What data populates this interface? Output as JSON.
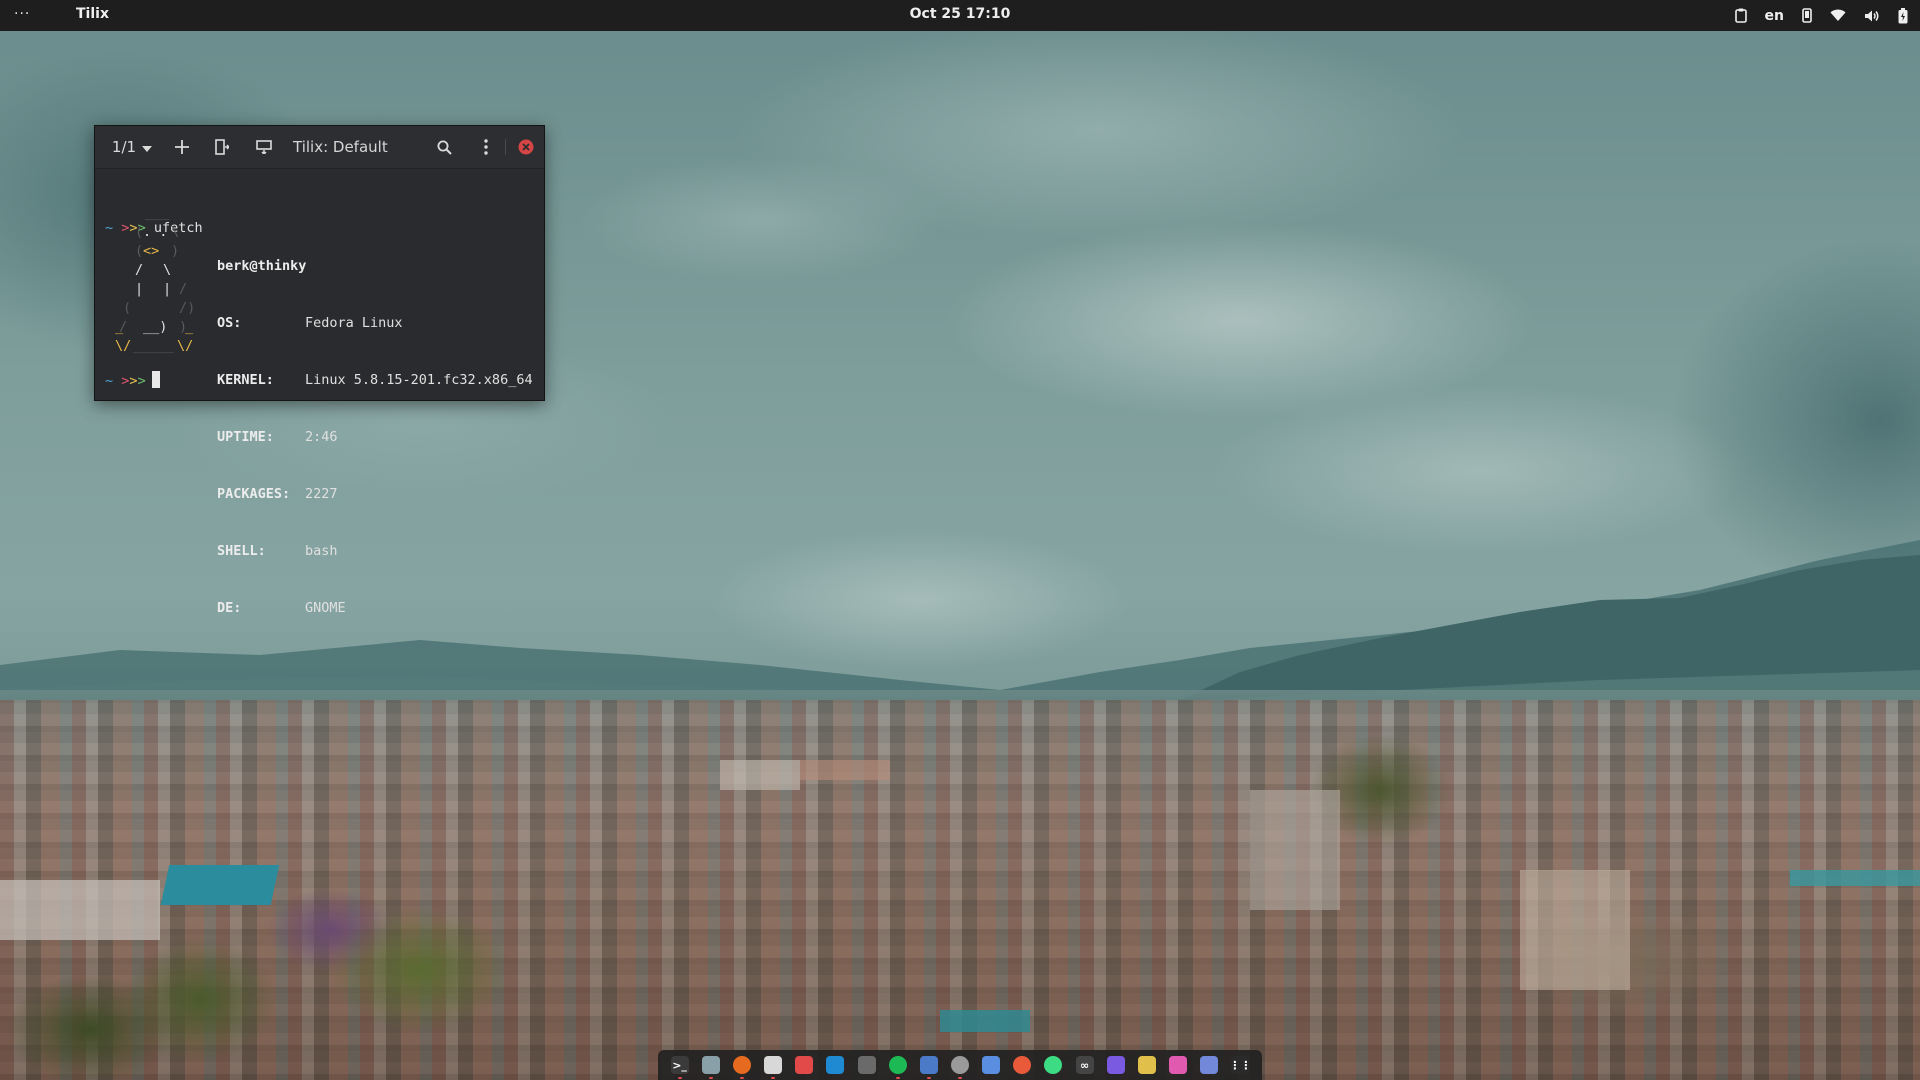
{
  "topbar": {
    "activities_label": "···",
    "app_name": "Tilix",
    "clock": "Oct 25  17:10",
    "language": "en"
  },
  "terminal": {
    "session_label": "1/1",
    "title": "Tilix: Default",
    "prompt_symbol": "~",
    "command": "ufetch",
    "user_host": "berk@thinky",
    "info": [
      {
        "key": "OS:",
        "value": "Fedora Linux"
      },
      {
        "key": "KERNEL:",
        "value": "Linux 5.8.15-201.fc32.x86_64"
      },
      {
        "key": "UPTIME:",
        "value": "2:46"
      },
      {
        "key": "PACKAGES:",
        "value": "2227"
      },
      {
        "key": "SHELL:",
        "value": "bash"
      },
      {
        "key": "DE:",
        "value": "GNOME"
      }
    ]
  },
  "dock": {
    "items": [
      {
        "name": "terminal-icon",
        "color": "#3a3a3a",
        "glyph": ">_"
      },
      {
        "name": "files-icon",
        "color": "#8aa0a8",
        "glyph": ""
      },
      {
        "name": "firefox-icon",
        "color": "#e66a1f",
        "glyph": ""
      },
      {
        "name": "software-icon",
        "color": "#d8d8d8",
        "glyph": ""
      },
      {
        "name": "calendar-icon",
        "color": "#e24a4a",
        "glyph": ""
      },
      {
        "name": "vscode-icon",
        "color": "#1f8ad2",
        "glyph": ""
      },
      {
        "name": "screenshot-icon",
        "color": "#6a6a6a",
        "glyph": ""
      },
      {
        "name": "spotify-icon",
        "color": "#1db954",
        "glyph": ""
      },
      {
        "name": "window-icon",
        "color": "#4a7ac8",
        "glyph": ""
      },
      {
        "name": "eye-icon",
        "color": "#9a9a9a",
        "glyph": ""
      },
      {
        "name": "document-icon",
        "color": "#5a8ee0",
        "glyph": ""
      },
      {
        "name": "mail-icon",
        "color": "#e85a3a",
        "glyph": ""
      },
      {
        "name": "android-icon",
        "color": "#3ddc84",
        "glyph": ""
      },
      {
        "name": "glasses-icon",
        "color": "#444444",
        "glyph": "∞"
      },
      {
        "name": "settings-icon",
        "color": "#7a5ae0",
        "glyph": ""
      },
      {
        "name": "camera-icon",
        "color": "#e0c04a",
        "glyph": ""
      },
      {
        "name": "colors-icon",
        "color": "#e05ab0",
        "glyph": ""
      },
      {
        "name": "discord-icon",
        "color": "#7289da",
        "glyph": ""
      },
      {
        "name": "app-grid-icon",
        "color": "#2a2a2a",
        "glyph": "⋮⋮"
      }
    ]
  }
}
